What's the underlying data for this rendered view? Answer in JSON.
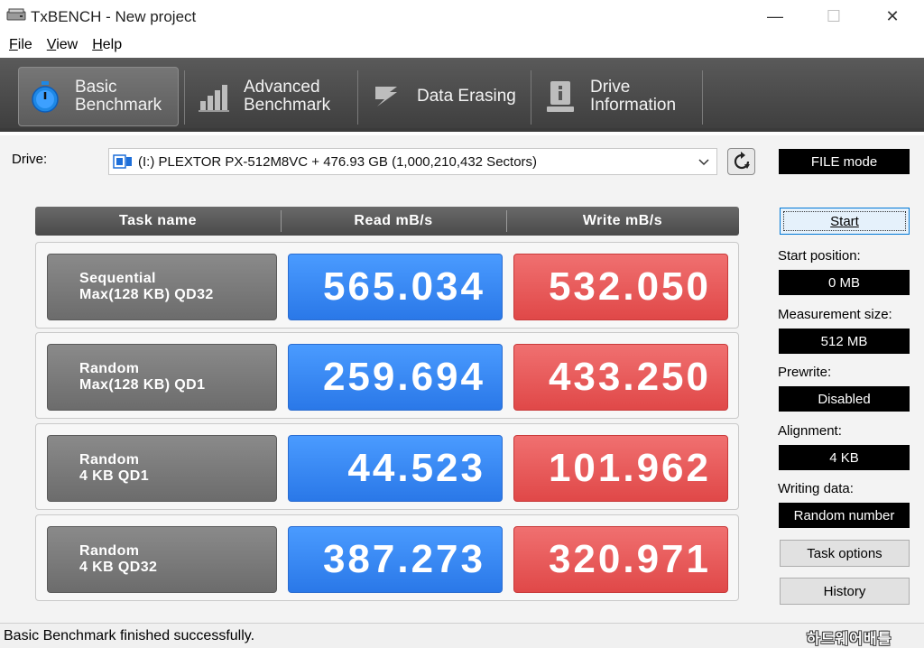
{
  "window": {
    "title": "TxBENCH - New project",
    "min_glyph": "—",
    "max_glyph": "☐",
    "close_glyph": "✕"
  },
  "menu": [
    {
      "label": "File",
      "accel": "F",
      "rest": "ile"
    },
    {
      "label": "View",
      "accel": "V",
      "rest": "iew"
    },
    {
      "label": "Help",
      "accel": "H",
      "rest": "elp"
    }
  ],
  "tabs": [
    {
      "line1": "Basic",
      "line2": "Benchmark",
      "icon": "stopwatch-icon",
      "active": true
    },
    {
      "line1": "Advanced",
      "line2": "Benchmark",
      "icon": "bar-chart-icon",
      "active": false
    },
    {
      "line1": "Data Erasing",
      "line2": "",
      "icon": "eraser-icon",
      "active": false
    },
    {
      "line1": "Drive",
      "line2": "Information",
      "icon": "drive-info-icon",
      "active": false
    }
  ],
  "drive": {
    "label": "Drive:",
    "value": "(I:) PLEXTOR PX-512M8VC +  476.93 GB (1,000,210,432 Sectors)"
  },
  "table": {
    "headers": [
      "Task name",
      "Read mB/s",
      "Write mB/s"
    ],
    "rows": [
      {
        "task_line1": "Sequential",
        "task_line2": "Max(128 KB) QD32",
        "read": "565.034",
        "write": "532.050"
      },
      {
        "task_line1": "Random",
        "task_line2": "Max(128 KB) QD1",
        "read": "259.694",
        "write": "433.250"
      },
      {
        "task_line1": "Random",
        "task_line2": "4 KB QD1",
        "read": "44.523",
        "write": "101.962"
      },
      {
        "task_line1": "Random",
        "task_line2": "4 KB QD32",
        "read": "387.273",
        "write": "320.971"
      }
    ]
  },
  "panel": {
    "mode": "FILE mode",
    "start_label": "Start",
    "start_position_label": "Start position:",
    "start_position_value": "0 MB",
    "measurement_size_label": "Measurement size:",
    "measurement_size_value": "512 MB",
    "prewrite_label": "Prewrite:",
    "prewrite_value": "Disabled",
    "alignment_label": "Alignment:",
    "alignment_value": "4 KB",
    "writing_data_label": "Writing data:",
    "writing_data_value": "Random number",
    "task_options_label": "Task options",
    "history_label": "History"
  },
  "status": {
    "text": "Basic Benchmark finished successfully.",
    "watermark": "하드웨어배틀"
  },
  "colors": {
    "read_blue": "#2a78e8",
    "write_red": "#e04848",
    "ribbon_dark": "#4a4a4a"
  }
}
